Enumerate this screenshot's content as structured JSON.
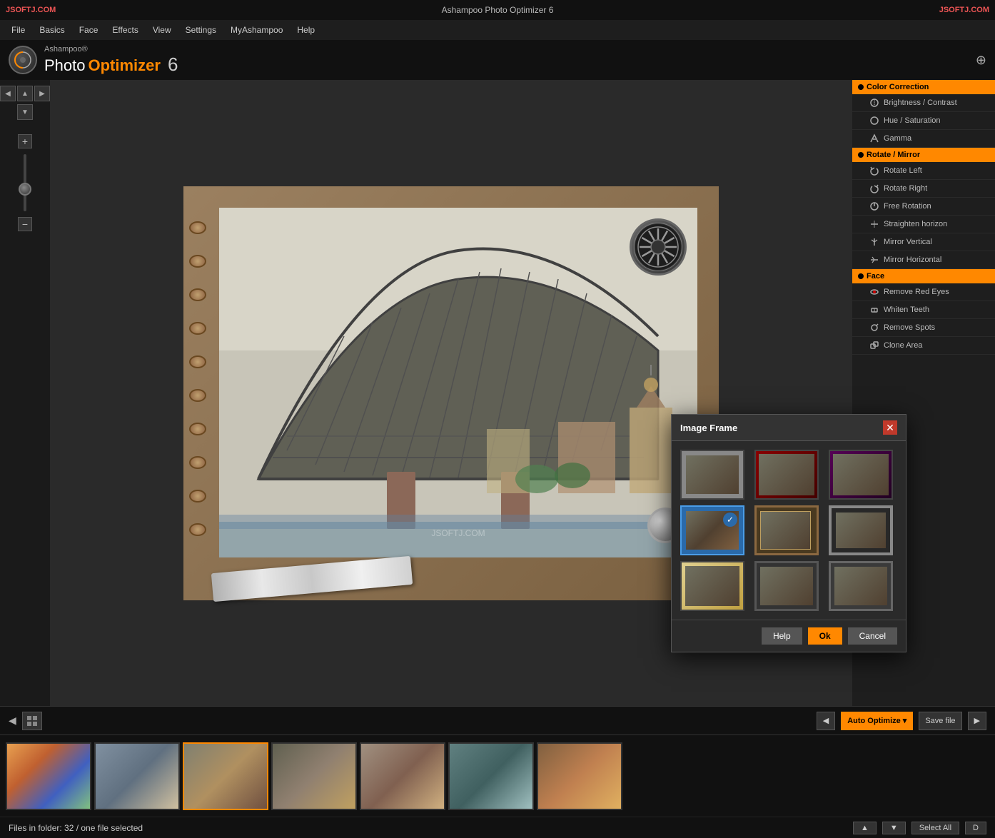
{
  "titlebar": {
    "watermark_left": "JSOFTJ.COM",
    "title": "Ashampoo Photo Optimizer 6",
    "watermark_right": "JSOFTJ.COM"
  },
  "menubar": {
    "items": [
      "File",
      "Basics",
      "Face",
      "Effects",
      "View",
      "Settings",
      "MyAshampoo",
      "Help"
    ]
  },
  "logobar": {
    "brand": "Ashampoo®",
    "photo": "Photo",
    "optimizer": "Optimizer",
    "version": "6"
  },
  "rightpanel": {
    "sections": [
      {
        "header": "Color Correction",
        "items": [
          "Brightness / Contrast",
          "Hue / Saturation",
          "Gamma"
        ]
      },
      {
        "header": "Rotate / Mirror",
        "items": [
          "Rotate Left",
          "Rotate Right",
          "Free Rotation",
          "Straighten horizon",
          "Mirror Vertical",
          "Mirror Horizontal"
        ]
      },
      {
        "header": "Face",
        "items": [
          "Remove Red Eyes",
          "Whiten Teeth",
          "Remove Spots",
          "Clone Area"
        ]
      }
    ]
  },
  "bottombar": {
    "expand_label": "◀",
    "forward_label": "▶",
    "auto_optimize_label": "Auto Optimize ▾",
    "save_file_label": "Save file",
    "next_label": "▶"
  },
  "filmstrip": {
    "thumbs": [
      {
        "id": "t1",
        "class": "thumb1"
      },
      {
        "id": "t2",
        "class": "thumb2"
      },
      {
        "id": "t3",
        "class": "thumb3",
        "selected": true
      },
      {
        "id": "t4",
        "class": "thumb4"
      },
      {
        "id": "t5",
        "class": "thumb5"
      },
      {
        "id": "t6",
        "class": "thumb6"
      },
      {
        "id": "t7",
        "class": "thumb7"
      }
    ]
  },
  "statusbar": {
    "text": "Files in folder: 32 / one file selected",
    "select_all_label": "Select All",
    "d_label": "D"
  },
  "dialog": {
    "title": "Image Frame",
    "close": "✕",
    "frames": [
      {
        "id": "f1",
        "class": "ft1",
        "selected": false
      },
      {
        "id": "f2",
        "class": "ft2",
        "selected": false
      },
      {
        "id": "f3",
        "class": "ft3",
        "selected": false
      },
      {
        "id": "f4",
        "class": "ft4",
        "selected": true
      },
      {
        "id": "f5",
        "class": "ft5",
        "selected": false
      },
      {
        "id": "f6",
        "class": "ft6",
        "selected": false
      },
      {
        "id": "f7",
        "class": "ft7",
        "selected": false
      },
      {
        "id": "f8",
        "class": "ft8",
        "selected": false
      },
      {
        "id": "f9",
        "class": "ft9",
        "selected": false
      }
    ],
    "help_label": "Help",
    "ok_label": "Ok",
    "cancel_label": "Cancel"
  }
}
